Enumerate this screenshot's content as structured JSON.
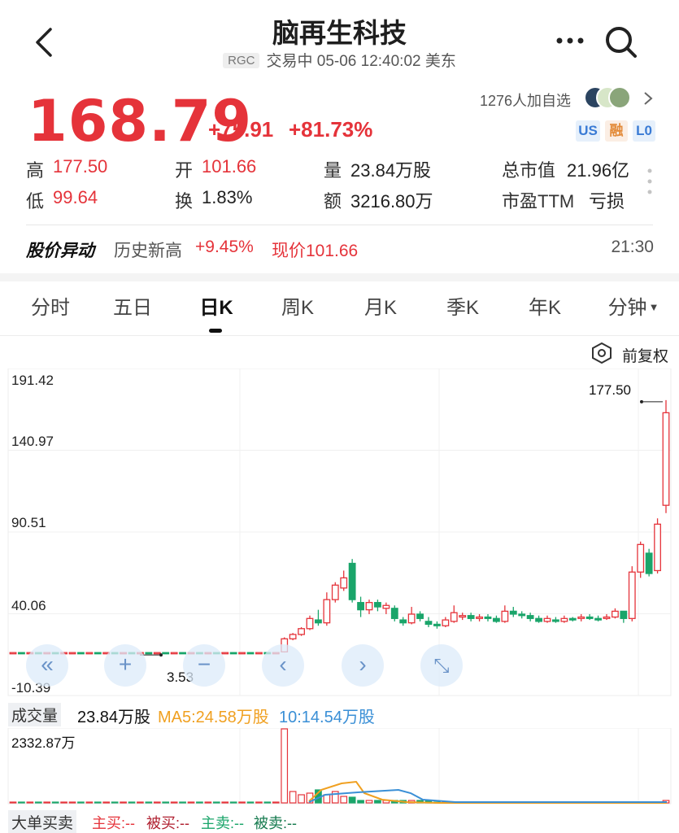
{
  "header": {
    "title": "脑再生科技",
    "ticker": "RGC",
    "status": "交易中 05-06 12:40:02 美东"
  },
  "quote": {
    "price": "168.79",
    "change": "+75.91",
    "change_pct": "+81.73%",
    "watchers": "1276人加自选",
    "badges": [
      "US",
      "融",
      "L0"
    ],
    "stats": {
      "high_label": "高",
      "high": "177.50",
      "open_label": "开",
      "open": "101.66",
      "volume_label": "量",
      "volume": "23.84万股",
      "mktcap_label": "总市值",
      "mktcap": "21.96亿",
      "low_label": "低",
      "low": "99.64",
      "turnover_label": "换",
      "turnover": "1.83%",
      "amount_label": "额",
      "amount": "3216.80万",
      "pe_label": "市盈TTM",
      "pe": "亏损"
    }
  },
  "alert": {
    "label": "股价异动",
    "text": "历史新高",
    "pct": "+9.45%",
    "price": "现价101.66",
    "time": "21:30"
  },
  "tabs": [
    "分时",
    "五日",
    "日K",
    "周K",
    "月K",
    "季K",
    "年K",
    "分钟"
  ],
  "adjust_label": "前复权",
  "chart_data": {
    "type": "candlestick",
    "y_ticks": [
      "191.42",
      "140.97",
      "90.51",
      "40.06",
      "-10.39"
    ],
    "ylim": [
      -10.39,
      191.42
    ],
    "max_label": "177.50",
    "min_label": "3.53",
    "candles": [
      [
        3.5,
        3.5,
        3.2,
        3.6
      ],
      [
        3.5,
        3.4,
        3.3,
        3.6
      ],
      [
        3.4,
        3.5,
        3.3,
        3.6
      ],
      [
        3.5,
        3.4,
        3.3,
        3.6
      ],
      [
        3.4,
        3.5,
        3.3,
        3.6
      ],
      [
        3.5,
        3.4,
        3.3,
        3.6
      ],
      [
        3.4,
        3.5,
        3.3,
        3.6
      ],
      [
        3.5,
        3.5,
        3.4,
        3.6
      ],
      [
        3.5,
        3.4,
        3.3,
        3.6
      ],
      [
        3.4,
        3.5,
        3.3,
        3.6
      ],
      [
        3.5,
        3.4,
        3.3,
        3.6
      ],
      [
        3.4,
        3.5,
        3.3,
        3.6
      ],
      [
        3.5,
        3.4,
        3.3,
        3.6
      ],
      [
        3.4,
        3.5,
        3.3,
        3.6
      ],
      [
        3.5,
        3.4,
        3.3,
        3.6
      ],
      [
        3.4,
        3.5,
        3.3,
        3.6
      ],
      [
        3.5,
        3.4,
        3.3,
        3.6
      ],
      [
        3.4,
        3.5,
        3.3,
        3.6
      ],
      [
        3.5,
        3.4,
        3.3,
        3.6
      ],
      [
        3.4,
        3.5,
        3.3,
        3.6
      ],
      [
        3.5,
        3.4,
        3.3,
        3.6
      ],
      [
        3.4,
        3.5,
        3.3,
        3.6
      ],
      [
        3.5,
        3.4,
        3.3,
        3.6
      ],
      [
        3.4,
        3.5,
        3.3,
        3.6
      ],
      [
        3.5,
        3.4,
        3.3,
        3.6
      ],
      [
        3.4,
        3.5,
        3.3,
        3.6
      ],
      [
        3.5,
        3.4,
        3.3,
        3.6
      ],
      [
        3.4,
        3.5,
        3.3,
        3.6
      ],
      [
        3.5,
        3.4,
        3.3,
        3.6
      ],
      [
        3.4,
        3.5,
        3.3,
        3.6
      ],
      [
        3.5,
        3.4,
        3.3,
        3.6
      ],
      [
        3.4,
        3.5,
        3.3,
        3.6
      ],
      [
        4,
        13,
        3.6,
        14
      ],
      [
        13,
        16,
        12,
        17
      ],
      [
        16,
        20,
        15,
        21
      ],
      [
        20,
        27,
        19,
        29
      ],
      [
        26,
        24,
        22,
        33
      ],
      [
        24,
        40,
        22,
        45
      ],
      [
        40,
        50,
        38,
        52
      ],
      [
        48,
        55,
        46,
        60
      ],
      [
        65,
        40,
        38,
        68
      ],
      [
        38,
        33,
        28,
        42
      ],
      [
        33,
        38,
        30,
        40
      ],
      [
        38,
        35,
        32,
        40
      ],
      [
        34,
        36,
        30,
        38
      ],
      [
        34,
        27,
        25,
        36
      ],
      [
        26,
        24,
        22,
        28
      ],
      [
        24,
        30,
        23,
        35
      ],
      [
        30,
        27,
        25,
        32
      ],
      [
        25,
        23,
        21,
        28
      ],
      [
        23,
        22,
        20,
        25
      ],
      [
        22,
        26,
        21,
        28
      ],
      [
        25,
        31,
        24,
        36
      ],
      [
        28,
        29,
        26,
        31
      ],
      [
        29,
        27,
        25,
        31
      ],
      [
        27,
        28,
        25,
        30
      ],
      [
        28,
        27,
        25,
        30
      ],
      [
        27,
        25,
        24,
        29
      ],
      [
        25,
        32,
        24,
        36
      ],
      [
        32,
        30,
        28,
        35
      ],
      [
        30,
        29,
        27,
        32
      ],
      [
        29,
        27,
        25,
        31
      ],
      [
        27,
        25,
        24,
        29
      ],
      [
        25,
        27,
        24,
        29
      ],
      [
        26,
        25,
        24,
        28
      ],
      [
        25,
        27,
        24,
        29
      ],
      [
        27,
        26,
        25,
        28
      ],
      [
        27,
        28,
        25,
        30
      ],
      [
        28,
        27,
        26,
        30
      ],
      [
        27,
        26,
        25,
        29
      ],
      [
        27,
        28,
        26,
        30
      ],
      [
        28,
        32,
        27,
        34
      ],
      [
        32,
        27,
        24,
        32
      ],
      [
        27,
        59,
        25,
        63
      ],
      [
        59,
        78,
        55,
        80
      ],
      [
        72,
        58,
        56,
        75
      ],
      [
        60,
        92,
        58,
        96
      ],
      [
        105,
        168.79,
        99.64,
        177.5
      ]
    ]
  },
  "volume": {
    "label": "成交量",
    "value": "23.84万股",
    "ma5": "MA5:24.58万股",
    "ma10": "10:14.54万股",
    "top": "2332.87万"
  },
  "bigorder": {
    "label": "大单买卖",
    "items": [
      "主买:--",
      "被买:--",
      "主卖:--",
      "被卖:--"
    ]
  },
  "colors": {
    "up": "#e5333a",
    "down": "#1aa56a",
    "ma5": "#f0a020",
    "ma10": "#3a8fd6"
  }
}
